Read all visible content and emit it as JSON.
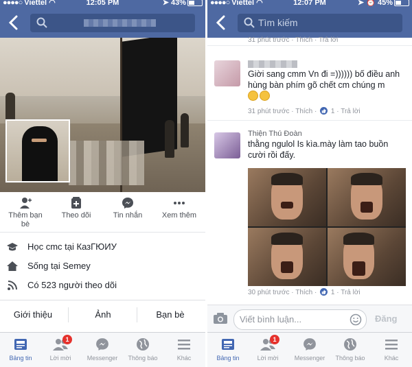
{
  "left": {
    "status": {
      "carrier": "Viettel",
      "time": "12:05 PM",
      "battery": "43%"
    },
    "actions": [
      {
        "label": "Thêm bạn bè",
        "icon": "add-friend-icon"
      },
      {
        "label": "Theo dõi",
        "icon": "follow-icon"
      },
      {
        "label": "Tin nhắn",
        "icon": "messenger-icon"
      },
      {
        "label": "Xem thêm",
        "icon": "more-icon"
      }
    ],
    "info": [
      {
        "text": "Học cmc tại КазГЮИУ",
        "icon": "education-icon"
      },
      {
        "text": "Sống tại Semey",
        "icon": "home-icon"
      },
      {
        "text": "Có 523 người theo dõi",
        "icon": "followers-icon"
      }
    ],
    "tabs": [
      "Giới thiệu",
      "Ảnh",
      "Bạn bè"
    ]
  },
  "right": {
    "status": {
      "carrier": "Viettel",
      "time": "12:07 PM",
      "battery": "45%"
    },
    "search_placeholder": "Tìm kiếm",
    "top_meta": {
      "time": "31 phút trước",
      "like": "Thích",
      "reply": "Trả lời"
    },
    "comments": [
      {
        "text": "Giời sang cmm Vn đi =)))))) bố điều anh hùng  bàn phím gõ chết cm chúng m",
        "time": "31 phút trước",
        "like": "Thích",
        "likes": "1",
        "reply": "Trả lời"
      },
      {
        "name_fragment": "Thiện Thủ Đoàn",
        "text": "thằng ngulol Is kìa.mày làm tao buồn cười rồi đấy.",
        "time": "30 phút trước",
        "like": "Thích",
        "likes": "1",
        "reply": "Trả lời"
      }
    ],
    "composer": {
      "placeholder": "Viết bình luận...",
      "send": "Đăng"
    }
  },
  "tabbar": [
    {
      "label": "Bảng tin",
      "icon": "news-feed-icon",
      "active": true
    },
    {
      "label": "Lời mời",
      "icon": "friend-requests-icon",
      "badge": "1"
    },
    {
      "label": "Messenger",
      "icon": "messenger-icon"
    },
    {
      "label": "Thông báo",
      "icon": "globe-icon"
    },
    {
      "label": "Khác",
      "icon": "menu-icon"
    }
  ],
  "colors": {
    "header": "#4e69a2",
    "accent": "#4267b2",
    "badge": "#e5322d"
  }
}
